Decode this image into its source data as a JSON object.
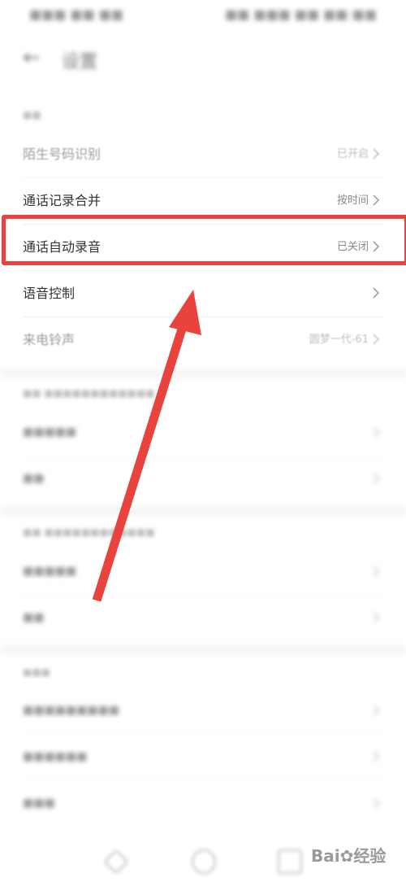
{
  "status_bar": {
    "left_text": "■■■ ■■ ■■",
    "right_text": "■■ ■■■ ■■ ■■:■■"
  },
  "header": {
    "back_icon": "arrow-left-icon",
    "title": "设置"
  },
  "section_label": "■■",
  "rows": [
    {
      "label": "陌生号码识别",
      "value": "已开启"
    },
    {
      "label": "通话记录合并",
      "value": "按时间"
    },
    {
      "label": "通话自动录音",
      "value": "已关闭"
    },
    {
      "label": "语音控制",
      "value": ""
    },
    {
      "label": "来电铃声",
      "value": "圆梦一代-61"
    }
  ],
  "blurred_sections": [
    {
      "label": "■■ ■■■■■■■■■■■■",
      "items": [
        "■■■■■",
        "■■"
      ]
    },
    {
      "label": "■■ ■■■■■■■■■■■■",
      "items": [
        "■■■■■",
        "■■"
      ]
    },
    {
      "label": "■■■",
      "items": [
        "■■■■■■■■■",
        "■■■■■■",
        "■■■"
      ]
    }
  ],
  "highlight_color": "#e8433d",
  "arrow_color": "#e8433d",
  "watermark": {
    "text": "Bai",
    "icon": "baidu-paw-icon",
    "suffix": "经验"
  }
}
